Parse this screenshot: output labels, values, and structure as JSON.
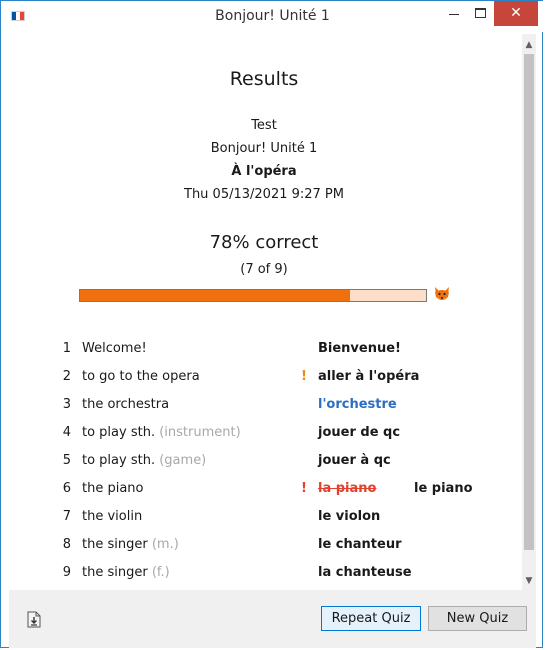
{
  "window": {
    "title": "Bonjour! Unité 1",
    "close_symbol": "✕"
  },
  "flag_colors": [
    "#0055a4",
    "#ffffff",
    "#ef4135"
  ],
  "colors": {
    "accent": "#f0700d",
    "progress_track": "#fddfc9",
    "correct_blue": "#2a6fc2",
    "wrong_red": "#e0422e",
    "warning": "#f08a10"
  },
  "results": {
    "title": "Results",
    "type": "Test",
    "course": "Bonjour! Unité 1",
    "lesson": "À l'opéra",
    "datetime": "Thu 05/13/2021 9:27 PM",
    "score": "78% correct",
    "count": "(7 of 9)",
    "progress_fraction": 0.78
  },
  "items": [
    {
      "num": "1",
      "en": "Welcome!",
      "note": "",
      "mark": "",
      "fr": "Bienvenue!",
      "style": "normal",
      "correction": ""
    },
    {
      "num": "2",
      "en": "to go to the opera",
      "note": "",
      "mark": "!",
      "mark_color": "#f08a10",
      "fr": "aller à l'opéra",
      "style": "normal",
      "correction": ""
    },
    {
      "num": "3",
      "en": "the orchestra",
      "note": "",
      "mark": "",
      "fr": "l'orchestre",
      "style": "blue",
      "correction": ""
    },
    {
      "num": "4",
      "en": "to play sth.",
      "note": "(instrument)",
      "mark": "",
      "fr": "jouer de qc",
      "style": "normal",
      "correction": ""
    },
    {
      "num": "5",
      "en": "to play sth.",
      "note": "(game)",
      "mark": "",
      "fr": "jouer à qc",
      "style": "normal",
      "correction": ""
    },
    {
      "num": "6",
      "en": "the piano",
      "note": "",
      "mark": "!",
      "mark_color": "#e0422e",
      "fr": "la piano",
      "style": "wrong",
      "correction": "le piano"
    },
    {
      "num": "7",
      "en": "the violin",
      "note": "",
      "mark": "",
      "fr": "le violon",
      "style": "normal",
      "correction": ""
    },
    {
      "num": "8",
      "en": "the singer",
      "note": "(m.)",
      "mark": "",
      "fr": "le chanteur",
      "style": "normal",
      "correction": ""
    },
    {
      "num": "9",
      "en": "the singer",
      "note": "(f.)",
      "mark": "",
      "fr": "la chanteuse",
      "style": "normal",
      "correction": ""
    }
  ],
  "footer": {
    "repeat_label": "Repeat Quiz",
    "new_label": "New Quiz",
    "export_icon": "download-file-icon"
  },
  "scroll": {
    "up_symbol": "▲",
    "down_symbol": "▼"
  }
}
